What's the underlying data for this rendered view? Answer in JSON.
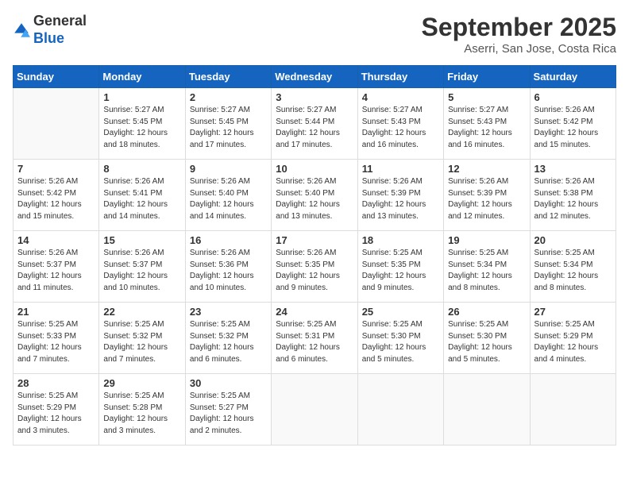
{
  "header": {
    "logo_line1": "General",
    "logo_line2": "Blue",
    "month_title": "September 2025",
    "subtitle": "Aserri, San Jose, Costa Rica"
  },
  "calendar": {
    "days_of_week": [
      "Sunday",
      "Monday",
      "Tuesday",
      "Wednesday",
      "Thursday",
      "Friday",
      "Saturday"
    ],
    "weeks": [
      [
        {
          "day": "",
          "info": ""
        },
        {
          "day": "1",
          "info": "Sunrise: 5:27 AM\nSunset: 5:45 PM\nDaylight: 12 hours\nand 18 minutes."
        },
        {
          "day": "2",
          "info": "Sunrise: 5:27 AM\nSunset: 5:45 PM\nDaylight: 12 hours\nand 17 minutes."
        },
        {
          "day": "3",
          "info": "Sunrise: 5:27 AM\nSunset: 5:44 PM\nDaylight: 12 hours\nand 17 minutes."
        },
        {
          "day": "4",
          "info": "Sunrise: 5:27 AM\nSunset: 5:43 PM\nDaylight: 12 hours\nand 16 minutes."
        },
        {
          "day": "5",
          "info": "Sunrise: 5:27 AM\nSunset: 5:43 PM\nDaylight: 12 hours\nand 16 minutes."
        },
        {
          "day": "6",
          "info": "Sunrise: 5:26 AM\nSunset: 5:42 PM\nDaylight: 12 hours\nand 15 minutes."
        }
      ],
      [
        {
          "day": "7",
          "info": "Sunrise: 5:26 AM\nSunset: 5:42 PM\nDaylight: 12 hours\nand 15 minutes."
        },
        {
          "day": "8",
          "info": "Sunrise: 5:26 AM\nSunset: 5:41 PM\nDaylight: 12 hours\nand 14 minutes."
        },
        {
          "day": "9",
          "info": "Sunrise: 5:26 AM\nSunset: 5:40 PM\nDaylight: 12 hours\nand 14 minutes."
        },
        {
          "day": "10",
          "info": "Sunrise: 5:26 AM\nSunset: 5:40 PM\nDaylight: 12 hours\nand 13 minutes."
        },
        {
          "day": "11",
          "info": "Sunrise: 5:26 AM\nSunset: 5:39 PM\nDaylight: 12 hours\nand 13 minutes."
        },
        {
          "day": "12",
          "info": "Sunrise: 5:26 AM\nSunset: 5:39 PM\nDaylight: 12 hours\nand 12 minutes."
        },
        {
          "day": "13",
          "info": "Sunrise: 5:26 AM\nSunset: 5:38 PM\nDaylight: 12 hours\nand 12 minutes."
        }
      ],
      [
        {
          "day": "14",
          "info": "Sunrise: 5:26 AM\nSunset: 5:37 PM\nDaylight: 12 hours\nand 11 minutes."
        },
        {
          "day": "15",
          "info": "Sunrise: 5:26 AM\nSunset: 5:37 PM\nDaylight: 12 hours\nand 10 minutes."
        },
        {
          "day": "16",
          "info": "Sunrise: 5:26 AM\nSunset: 5:36 PM\nDaylight: 12 hours\nand 10 minutes."
        },
        {
          "day": "17",
          "info": "Sunrise: 5:26 AM\nSunset: 5:35 PM\nDaylight: 12 hours\nand 9 minutes."
        },
        {
          "day": "18",
          "info": "Sunrise: 5:25 AM\nSunset: 5:35 PM\nDaylight: 12 hours\nand 9 minutes."
        },
        {
          "day": "19",
          "info": "Sunrise: 5:25 AM\nSunset: 5:34 PM\nDaylight: 12 hours\nand 8 minutes."
        },
        {
          "day": "20",
          "info": "Sunrise: 5:25 AM\nSunset: 5:34 PM\nDaylight: 12 hours\nand 8 minutes."
        }
      ],
      [
        {
          "day": "21",
          "info": "Sunrise: 5:25 AM\nSunset: 5:33 PM\nDaylight: 12 hours\nand 7 minutes."
        },
        {
          "day": "22",
          "info": "Sunrise: 5:25 AM\nSunset: 5:32 PM\nDaylight: 12 hours\nand 7 minutes."
        },
        {
          "day": "23",
          "info": "Sunrise: 5:25 AM\nSunset: 5:32 PM\nDaylight: 12 hours\nand 6 minutes."
        },
        {
          "day": "24",
          "info": "Sunrise: 5:25 AM\nSunset: 5:31 PM\nDaylight: 12 hours\nand 6 minutes."
        },
        {
          "day": "25",
          "info": "Sunrise: 5:25 AM\nSunset: 5:30 PM\nDaylight: 12 hours\nand 5 minutes."
        },
        {
          "day": "26",
          "info": "Sunrise: 5:25 AM\nSunset: 5:30 PM\nDaylight: 12 hours\nand 5 minutes."
        },
        {
          "day": "27",
          "info": "Sunrise: 5:25 AM\nSunset: 5:29 PM\nDaylight: 12 hours\nand 4 minutes."
        }
      ],
      [
        {
          "day": "28",
          "info": "Sunrise: 5:25 AM\nSunset: 5:29 PM\nDaylight: 12 hours\nand 3 minutes."
        },
        {
          "day": "29",
          "info": "Sunrise: 5:25 AM\nSunset: 5:28 PM\nDaylight: 12 hours\nand 3 minutes."
        },
        {
          "day": "30",
          "info": "Sunrise: 5:25 AM\nSunset: 5:27 PM\nDaylight: 12 hours\nand 2 minutes."
        },
        {
          "day": "",
          "info": ""
        },
        {
          "day": "",
          "info": ""
        },
        {
          "day": "",
          "info": ""
        },
        {
          "day": "",
          "info": ""
        }
      ]
    ]
  }
}
